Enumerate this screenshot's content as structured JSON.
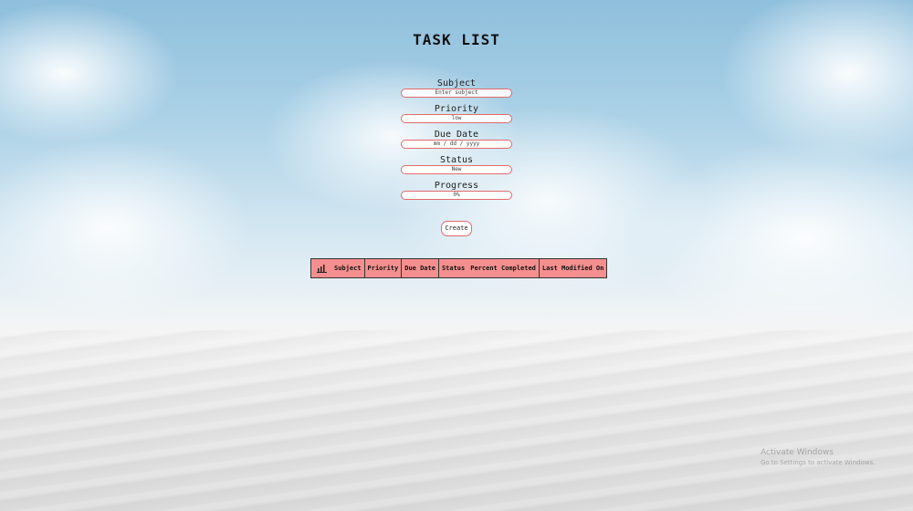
{
  "page": {
    "title": "TASK LIST"
  },
  "form": {
    "fields": [
      {
        "label": "Subject",
        "value": "Enter subject"
      },
      {
        "label": "Priority",
        "value": "low"
      },
      {
        "label": "Due Date",
        "value": "mm / dd / yyyy"
      },
      {
        "label": "Status",
        "value": "New"
      },
      {
        "label": "Progress",
        "value": "0%"
      }
    ],
    "create_label": "Create"
  },
  "table": {
    "icon": "bar-chart-icon",
    "columns": [
      "Subject",
      "Priority",
      "Due Date",
      "Status",
      "Percent Completed",
      "Last Modified On"
    ]
  },
  "watermark": {
    "title": "Activate Windows",
    "subtitle": "Go to Settings to activate Windows."
  },
  "colors": {
    "accent": "#e46a6a",
    "table_header": "#f58f8f"
  }
}
